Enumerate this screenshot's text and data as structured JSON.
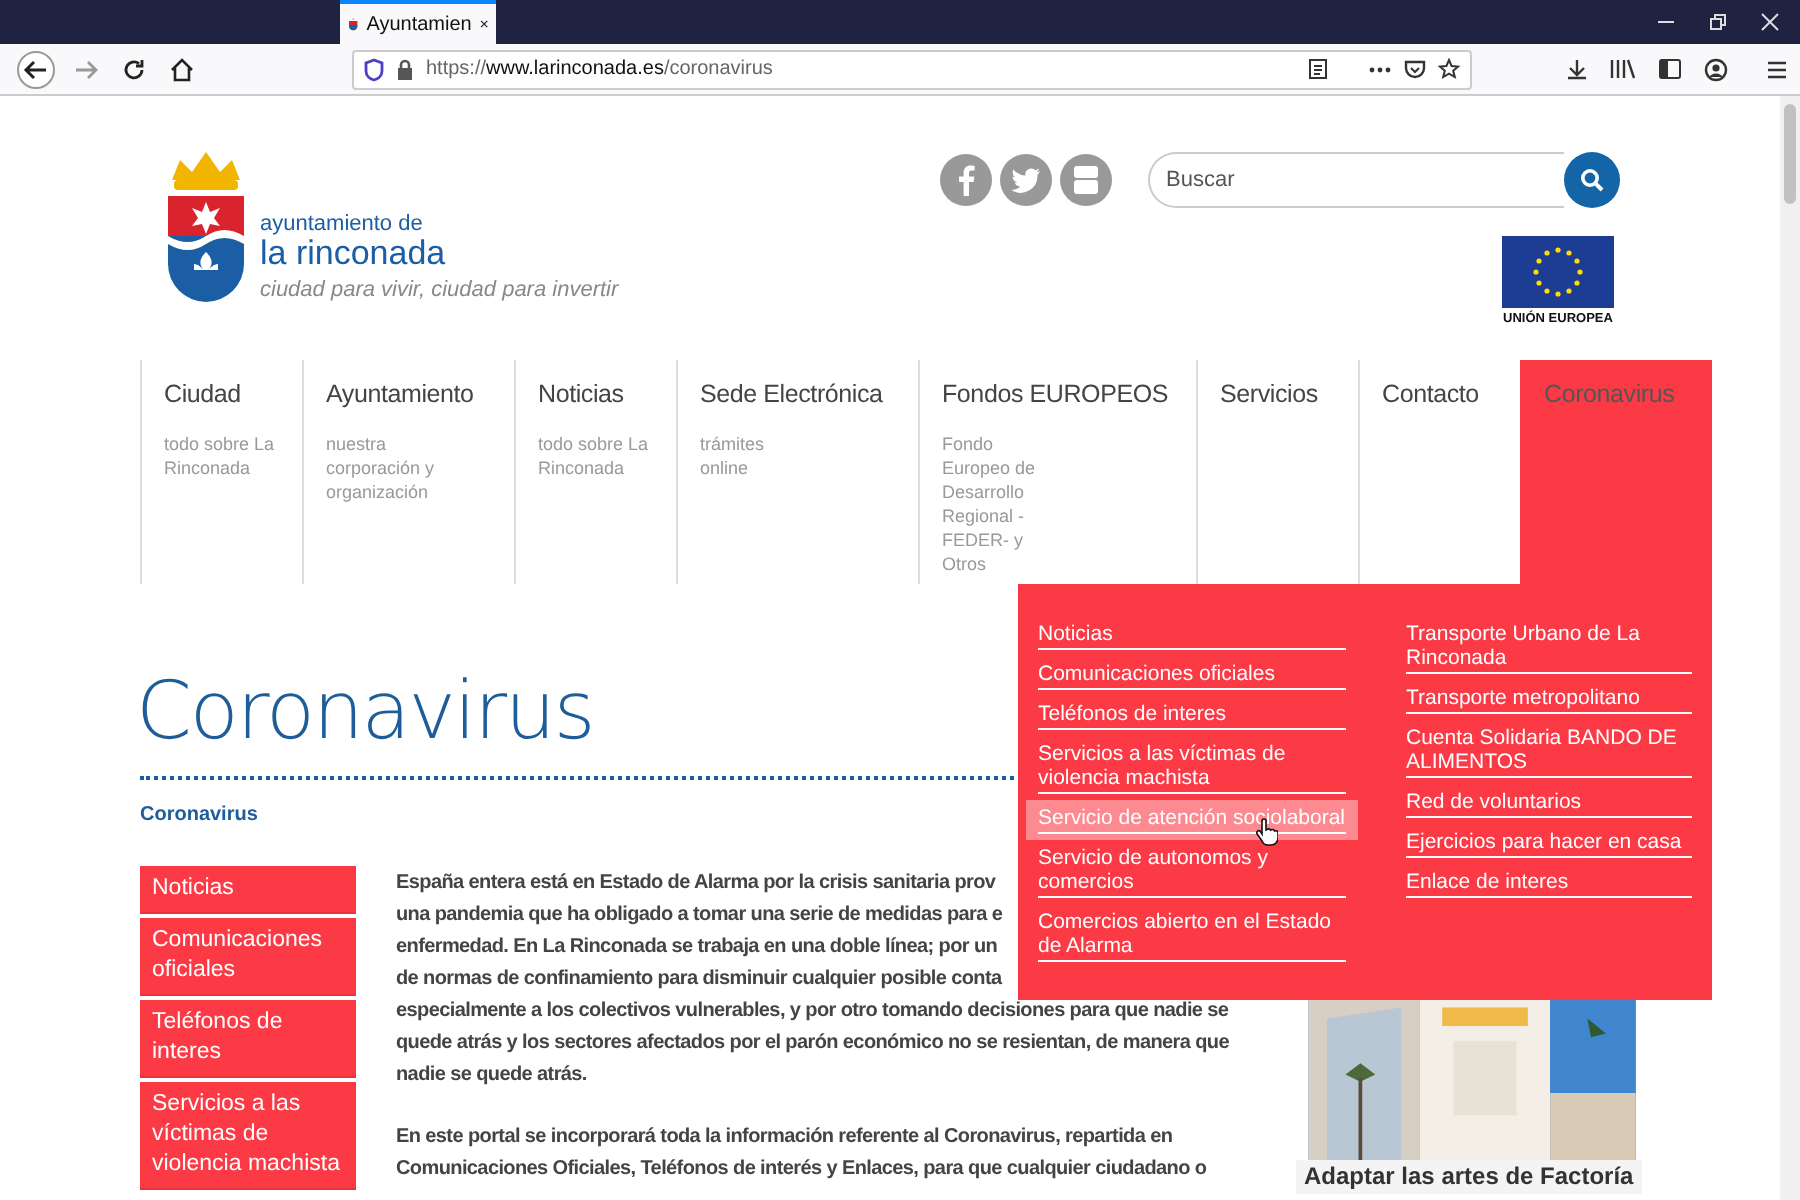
{
  "browser": {
    "tab_title": "Ayuntamien",
    "url_scheme": "https://",
    "url_host": "www.larinconada.es",
    "url_path": "/coronavirus"
  },
  "header": {
    "logo_line1": "ayuntamiento de",
    "logo_line2": "la rinconada",
    "tagline": "ciudad para vivir, ciudad para invertir",
    "search": {
      "placeholder": "Buscar"
    },
    "eu_label": "UNIÓN EUROPEA"
  },
  "nav": [
    {
      "label": "Ciudad",
      "sub": "todo sobre La Rinconada",
      "selected": false
    },
    {
      "label": "Ayuntamiento",
      "sub": "nuestra corporación y organización",
      "selected": false
    },
    {
      "label": "Noticias",
      "sub": "todo sobre La Rinconada",
      "selected": false
    },
    {
      "label": "Sede Electrónica",
      "sub": "trámites online",
      "selected": false
    },
    {
      "label": "Fondos EUROPEOS",
      "sub": "Fondo Europeo de Desarrollo Regional -FEDER- y Otros",
      "selected": false
    },
    {
      "label": "Servicios",
      "selected": false
    },
    {
      "label": "Contacto",
      "selected": false
    },
    {
      "label": "Coronavirus",
      "selected": true
    }
  ],
  "dropdown": {
    "columns": [
      [
        {
          "label": "Noticias",
          "hovered": false
        },
        {
          "label": "Comunicaciones oficiales",
          "hovered": false
        },
        {
          "label": "Teléfonos de interes",
          "hovered": false
        },
        {
          "label": "Servicios a las víctimas de violencia machista",
          "hovered": false
        },
        {
          "label": "Servicio de atención sociolaboral",
          "hovered": true
        },
        {
          "label": "Servicio de autonomos y comercios",
          "hovered": false
        },
        {
          "label": "Comercios abierto en el Estado de Alarma",
          "hovered": false
        }
      ],
      [
        {
          "label": "Transporte Urbano de La Rinconada",
          "hovered": false
        },
        {
          "label": "Transporte metropolitano",
          "hovered": false
        },
        {
          "label": "Cuenta Solidaria BANDO DE ALIMENTOS",
          "hovered": false
        },
        {
          "label": "Red de voluntarios",
          "hovered": false
        },
        {
          "label": "Ejercicios para hacer en casa",
          "hovered": false
        },
        {
          "label": "Enlace de interes",
          "hovered": false
        }
      ]
    ]
  },
  "page_title": "Coronavirus",
  "breadcrumb": "Coronavirus",
  "sidebar": {
    "items": [
      "Noticias",
      "Comunicaciones oficiales",
      "Teléfonos de interes",
      "Servicios a las víctimas de violencia machista"
    ]
  },
  "paragraphs": [
    {
      "lines": [
        "España entera está en Estado de Alarma por la crisis sanitaria prov",
        "una pandemia que ha obligado a tomar una serie de medidas para e",
        "enfermedad. En La Rinconada se trabaja en una doble línea; por un",
        "de normas de confinamiento para disminuir cualquier posible conta",
        "especialmente a los colectivos vulnerables, y por otro tomando decisiones para que nadie se",
        "quede atrás y los sectores afectados por el parón económico no se resientan, de manera que",
        "nadie se quede atrás."
      ]
    },
    {
      "lines": [
        "En este portal se incorporará toda la información referente al Coronavirus, repartida en",
        "Comunicaciones Oficiales, Teléfonos de interés y Enlaces, para que cualquier ciudadano o"
      ]
    }
  ],
  "card": {
    "title": "Adaptar las artes de Factoría"
  }
}
